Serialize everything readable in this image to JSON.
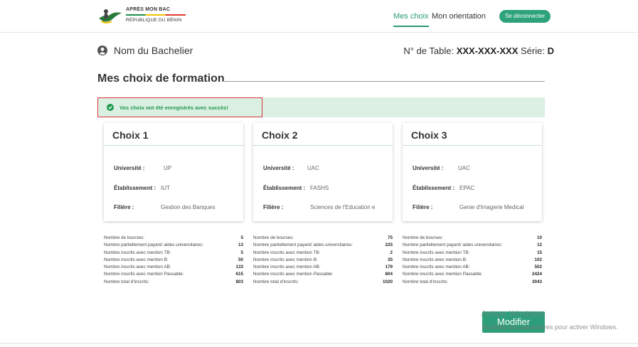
{
  "header": {
    "logo_title": "APRÈS MON BAC",
    "logo_subtitle": "RÉPUBLIQUE DU BÉNIN",
    "nav": {
      "mes_choix": "Mes choix",
      "mon_orientation": "Mon orientation",
      "logout": "Se déconnecter"
    }
  },
  "student": {
    "name": "Nom du Bachelier",
    "table_label": "N° de Table:",
    "table_value": "XXX-XXX-XXX",
    "serie_label": "Série:",
    "serie_value": "D"
  },
  "section": {
    "title": "Mes choix de formation"
  },
  "alert": {
    "message": "Vos choix ont été enregistrés avec succès!"
  },
  "labels": {
    "universite": "Université :",
    "etablissement": "Établissement :",
    "filiere": "Filière :",
    "bourses": "Nombre de bourses:",
    "partiel": "Nombre partiellement payant/ aides universitaires:",
    "tb": "Nombre inscrits avec mention TB:",
    "b": "Nombre inscrits avec mention B:",
    "ab": "Nombre inscrits avec mention AB:",
    "passable": "Nombre inscrits avec mention Passable:",
    "total": "Nombre total d'inscrits:"
  },
  "choices": [
    {
      "title": "Choix 1",
      "universite": "UP",
      "etablissement": "IUT",
      "filiere": "Gestion des Banques",
      "stats": {
        "bourses": "5",
        "partiel": "13",
        "tb": "5",
        "b": "50",
        "ab": "133",
        "passable": "615",
        "total": "803"
      }
    },
    {
      "title": "Choix 2",
      "universite": "UAC",
      "etablissement": "FASHS",
      "filiere": "Sciences de l'Education e",
      "stats": {
        "bourses": "75",
        "partiel": "225",
        "tb": "2",
        "b": "35",
        "ab": "179",
        "passable": "804",
        "total": "1020"
      }
    },
    {
      "title": "Choix 3",
      "universite": "UAC",
      "etablissement": "EPAC",
      "filiere": "Genie d'Imagerie Medical",
      "stats": {
        "bourses": "10",
        "partiel": "12",
        "tb": "15",
        "b": "102",
        "ab": "502",
        "passable": "2424",
        "total": "3043"
      }
    }
  ],
  "actions": {
    "modifier": "Modifier"
  },
  "watermark": {
    "line1": "Activer Windows",
    "line2": "Accédez aux paramètres pour activer Windows."
  },
  "colors": {
    "accent": "#2ea37a",
    "alert_bg": "#dcefe3",
    "alert_text": "#1e9a4e",
    "highlight_border": "#d43838"
  }
}
